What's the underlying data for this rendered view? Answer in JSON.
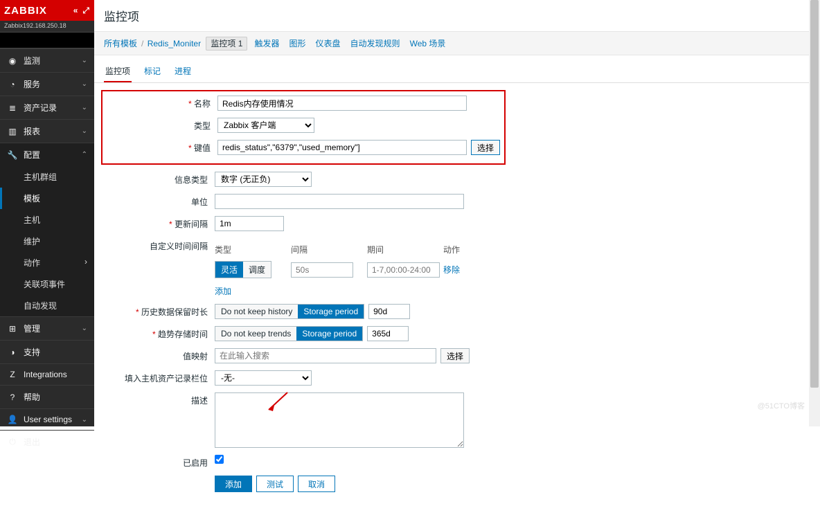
{
  "logo": "ZABBIX",
  "server_addr": "Zabbix192.168.250.18",
  "page_title": "监控项",
  "breadcrumb": {
    "all_tpl": "所有模板",
    "tpl": "Redis_Moniter",
    "current": "监控项 1",
    "tabs": [
      "触发器",
      "图形",
      "仪表盘",
      "自动发现规则",
      "Web 场景"
    ]
  },
  "inner_tabs": {
    "t1": "监控项",
    "t2": "标记",
    "t3": "进程"
  },
  "sidebar": {
    "items": [
      {
        "icon": "◉",
        "label": "监测"
      },
      {
        "icon": "◔",
        "label": "服务"
      },
      {
        "icon": "≣",
        "label": "资产记录"
      },
      {
        "icon": "▥",
        "label": "报表"
      },
      {
        "icon": "🔧",
        "label": "配置"
      },
      {
        "icon": "⊞",
        "label": "管理"
      },
      {
        "icon": "◑",
        "label": "支持"
      },
      {
        "icon": "Z",
        "label": "Integrations"
      },
      {
        "icon": "?",
        "label": "帮助"
      },
      {
        "icon": "👤",
        "label": "User settings"
      },
      {
        "icon": "⏻",
        "label": "退出"
      }
    ],
    "sub": [
      "主机群组",
      "模板",
      "主机",
      "维护",
      "动作",
      "关联项事件",
      "自动发现"
    ]
  },
  "form": {
    "name_label": "名称",
    "name_value": "Redis内存使用情况",
    "type_label": "类型",
    "type_value": "Zabbix 客户端",
    "key_label": "键值",
    "key_value": "redis_status\",\"6379\",\"used_memory\"]",
    "key_btn": "选择",
    "info_label": "信息类型",
    "info_value": "数字 (无正负)",
    "unit_label": "单位",
    "interval_label": "更新间隔",
    "interval_value": "1m",
    "custom_label": "自定义时间间隔",
    "ihead": {
      "c1": "类型",
      "c2": "间隔",
      "c3": "期间",
      "c4": "动作"
    },
    "seg": {
      "a": "灵活",
      "b": "调度"
    },
    "ival_ph": "50s",
    "period_ph": "1-7,00:00-24:00",
    "remove": "移除",
    "add": "添加",
    "hist_label": "历史数据保留时长",
    "hist_a": "Do not keep history",
    "hist_b": "Storage period",
    "hist_v": "90d",
    "trend_label": "趋势存储时间",
    "trend_a": "Do not keep trends",
    "trend_b": "Storage period",
    "trend_v": "365d",
    "map_label": "值映射",
    "map_ph": "在此输入搜索",
    "map_btn": "选择",
    "inv_label": "填入主机资产记录栏位",
    "inv_value": "-无-",
    "desc_label": "描述",
    "en_label": "已启用",
    "btn_add": "添加",
    "btn_test": "测试",
    "btn_cancel": "取消"
  },
  "watermark": "@51CTO博客"
}
